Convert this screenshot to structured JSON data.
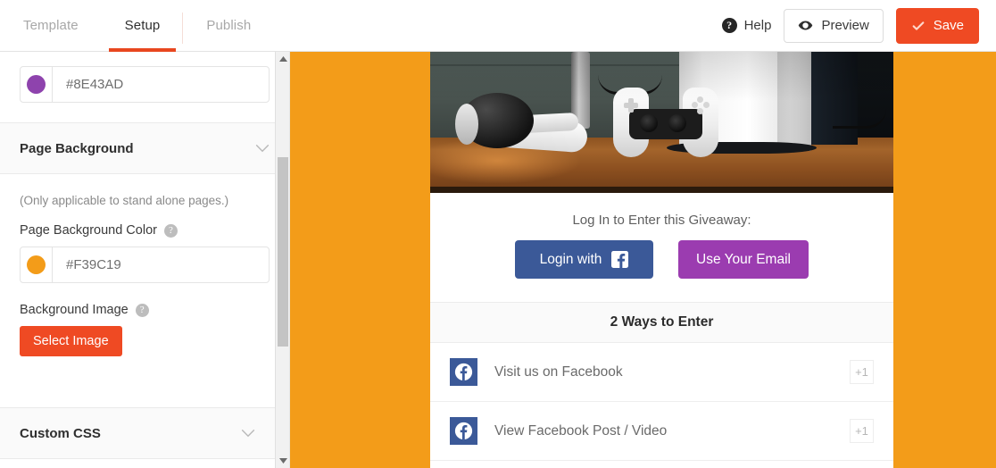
{
  "header": {
    "tabs": [
      {
        "label": "Template",
        "active": false
      },
      {
        "label": "Setup",
        "active": true
      },
      {
        "label": "Publish",
        "active": false
      }
    ],
    "help_label": "Help",
    "preview_label": "Preview",
    "save_label": "Save",
    "save_color": "#EF4A23",
    "active_tab_underline_color": "#E8471F"
  },
  "sidebar": {
    "top_color_field": {
      "value": "#8E43AD",
      "swatch_color": "#8E43AD"
    },
    "sections": [
      {
        "title": "Page Background",
        "expanded": true,
        "note": "(Only applicable to stand alone pages.)",
        "color_label": "Page Background Color",
        "color_value": "#F39C19",
        "color_swatch": "#F39C19",
        "image_label": "Background Image",
        "select_image_label": "Select Image"
      },
      {
        "title": "Custom CSS",
        "expanded": false
      }
    ]
  },
  "preview": {
    "page_background_color": "#F39C19",
    "hero_image_alt": "PlayStation 5 console with DualSense controller and white headphones on a wooden desk",
    "login_prompt": "Log In to Enter this Giveaway:",
    "login_facebook_label": "Login with",
    "login_facebook_color": "#3B5998",
    "login_email_label": "Use Your Email",
    "login_email_color": "#9B3CB0",
    "ways_title": "2 Ways to Enter",
    "entries": [
      {
        "label": "Visit us on Facebook",
        "points": "+1",
        "icon": "facebook-icon"
      },
      {
        "label": "View Facebook Post / Video",
        "points": "+1",
        "icon": "facebook-icon"
      }
    ]
  }
}
